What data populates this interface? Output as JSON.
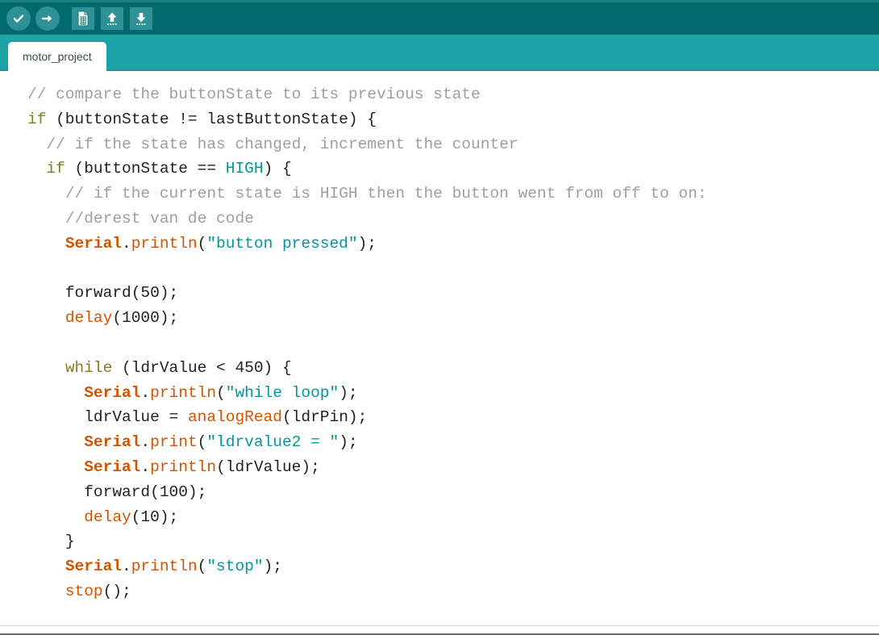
{
  "window": {
    "colors": {
      "toolbar_bg": "#006a6e",
      "tabbar_bg": "#1ba3a8",
      "tab_active_bg": "#ffffff",
      "editor_bg": "#ffffff",
      "comment": "#9aa0a6",
      "keyword": "#7e7e22",
      "literal": "#00979c",
      "string": "#00979c",
      "function": "#d35400",
      "plain": "#222222"
    }
  },
  "toolbar": {
    "buttons": [
      {
        "name": "verify-button",
        "icon": "checkmark-circle-icon",
        "label": "Verify"
      },
      {
        "name": "upload-button",
        "icon": "arrow-right-circle-icon",
        "label": "Upload"
      },
      {
        "name": "new-button",
        "icon": "new-file-icon",
        "label": "New"
      },
      {
        "name": "open-button",
        "icon": "arrow-up-icon",
        "label": "Open"
      },
      {
        "name": "save-button",
        "icon": "arrow-down-icon",
        "label": "Save"
      }
    ]
  },
  "tabs": {
    "active_index": 0,
    "items": [
      {
        "label": "motor_project"
      }
    ]
  },
  "editor": {
    "lines": [
      {
        "indent": 0,
        "tokens": [
          {
            "t": "// compare the buttonState to its previous state",
            "c": "cmt"
          }
        ]
      },
      {
        "indent": 0,
        "tokens": [
          {
            "t": "if",
            "c": "kw"
          },
          {
            "t": " (buttonState != lastButtonState) {",
            "c": "pln"
          }
        ]
      },
      {
        "indent": 1,
        "tokens": [
          {
            "t": "// if the state has changed, increment the counter",
            "c": "cmt"
          }
        ]
      },
      {
        "indent": 1,
        "tokens": [
          {
            "t": "if",
            "c": "kw"
          },
          {
            "t": " (buttonState == ",
            "c": "pln"
          },
          {
            "t": "HIGH",
            "c": "lit"
          },
          {
            "t": ") {",
            "c": "pln"
          }
        ]
      },
      {
        "indent": 2,
        "tokens": [
          {
            "t": "// if the current state is HIGH then the button went from off to on:",
            "c": "cmt"
          }
        ]
      },
      {
        "indent": 2,
        "tokens": [
          {
            "t": "//derest van de code",
            "c": "cmt"
          }
        ]
      },
      {
        "indent": 2,
        "tokens": [
          {
            "t": "Serial",
            "c": "obj"
          },
          {
            "t": ".",
            "c": "pln"
          },
          {
            "t": "println",
            "c": "fn"
          },
          {
            "t": "(",
            "c": "pln"
          },
          {
            "t": "\"button pressed\"",
            "c": "str"
          },
          {
            "t": ");",
            "c": "pln"
          }
        ]
      },
      {
        "indent": 0,
        "tokens": []
      },
      {
        "indent": 2,
        "tokens": [
          {
            "t": "forward(50);",
            "c": "pln"
          }
        ]
      },
      {
        "indent": 2,
        "tokens": [
          {
            "t": "delay",
            "c": "fn"
          },
          {
            "t": "(1000);",
            "c": "pln"
          }
        ]
      },
      {
        "indent": 0,
        "tokens": []
      },
      {
        "indent": 2,
        "tokens": [
          {
            "t": "while",
            "c": "kw"
          },
          {
            "t": " (ldrValue < 450) {",
            "c": "pln"
          }
        ]
      },
      {
        "indent": 3,
        "tokens": [
          {
            "t": "Serial",
            "c": "obj"
          },
          {
            "t": ".",
            "c": "pln"
          },
          {
            "t": "println",
            "c": "fn"
          },
          {
            "t": "(",
            "c": "pln"
          },
          {
            "t": "\"while loop\"",
            "c": "str"
          },
          {
            "t": ");",
            "c": "pln"
          }
        ]
      },
      {
        "indent": 3,
        "tokens": [
          {
            "t": "ldrValue = ",
            "c": "pln"
          },
          {
            "t": "analogRead",
            "c": "fn"
          },
          {
            "t": "(ldrPin);",
            "c": "pln"
          }
        ]
      },
      {
        "indent": 3,
        "tokens": [
          {
            "t": "Serial",
            "c": "obj"
          },
          {
            "t": ".",
            "c": "pln"
          },
          {
            "t": "print",
            "c": "fn"
          },
          {
            "t": "(",
            "c": "pln"
          },
          {
            "t": "\"ldrvalue2 = \"",
            "c": "str"
          },
          {
            "t": ");",
            "c": "pln"
          }
        ]
      },
      {
        "indent": 3,
        "tokens": [
          {
            "t": "Serial",
            "c": "obj"
          },
          {
            "t": ".",
            "c": "pln"
          },
          {
            "t": "println",
            "c": "fn"
          },
          {
            "t": "(ldrValue);",
            "c": "pln"
          }
        ]
      },
      {
        "indent": 3,
        "tokens": [
          {
            "t": "forward(100);",
            "c": "pln"
          }
        ]
      },
      {
        "indent": 3,
        "tokens": [
          {
            "t": "delay",
            "c": "fn"
          },
          {
            "t": "(10);",
            "c": "pln"
          }
        ]
      },
      {
        "indent": 2,
        "tokens": [
          {
            "t": "}",
            "c": "pln"
          }
        ]
      },
      {
        "indent": 2,
        "tokens": [
          {
            "t": "Serial",
            "c": "obj"
          },
          {
            "t": ".",
            "c": "pln"
          },
          {
            "t": "println",
            "c": "fn"
          },
          {
            "t": "(",
            "c": "pln"
          },
          {
            "t": "\"stop\"",
            "c": "str"
          },
          {
            "t": ");",
            "c": "pln"
          }
        ]
      },
      {
        "indent": 2,
        "tokens": [
          {
            "t": "stop",
            "c": "fn"
          },
          {
            "t": "();",
            "c": "pln"
          }
        ]
      }
    ]
  }
}
